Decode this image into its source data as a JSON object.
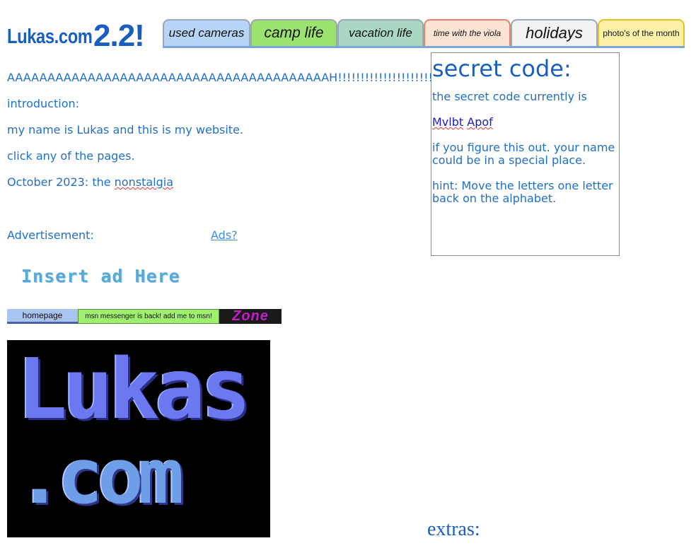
{
  "header": {
    "logo_name": "Lukas.com",
    "logo_version": "2.2!",
    "tabs": [
      {
        "label": "used cameras"
      },
      {
        "label": "camp life"
      },
      {
        "label": "vacation life"
      },
      {
        "label": "time with the viola"
      },
      {
        "label": "holidays"
      },
      {
        "label": "photo's of the month"
      }
    ]
  },
  "main": {
    "scream": "AAAAAAAAAAAAAAAAAAAAAAAAAAAAAAAAAAAAAAAAH!!!!!!!!!!!!!!!!!!!!!",
    "intro_heading": "introduction:",
    "intro_text": "my name is Lukas and this is my website.",
    "click_text": "click any of the pages.",
    "news_prefix": "October 2023: the ",
    "news_link": "nonstalgia",
    "advertisement_label": "Advertisement:",
    "ads_link": "Ads?",
    "insert_ad": "Insert ad Here"
  },
  "buttons": {
    "homepage": "homepage",
    "msn": "msn messenger is back! add me to msn!",
    "zone": "Zone"
  },
  "big_logo": {
    "line1": "Lukas",
    "line2": ".com"
  },
  "secret": {
    "title": "secret code:",
    "intro": "the secret code currently is",
    "code_word1": "Mvlbt",
    "code_word2": "Apof",
    "figure": "if you figure this out. your name could be in a special place.",
    "hint": "hint: Move the letters one letter back on the alphabet."
  },
  "extras": "extras:",
  "colors": {
    "text_blue": "#1f6fc9",
    "cameras_tab": "#b6d4f6",
    "camp_tab": "#9be36e",
    "vacation_tab": "#a9d7c1",
    "viola_tab": "#fde3d4",
    "holidays_tab": "#f2f2f2",
    "photo_tab": "#fff2a8"
  }
}
